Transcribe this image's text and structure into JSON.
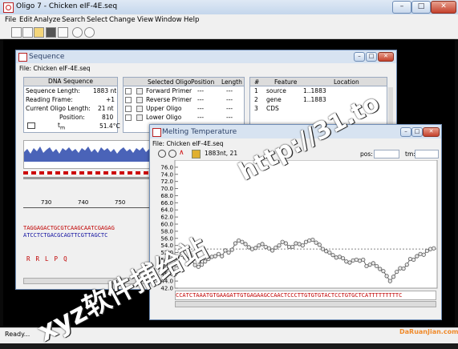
{
  "app": {
    "title": "Oligo 7 - Chicken eIF-4E.seq",
    "status": "Ready..."
  },
  "menu": [
    "File",
    "Edit",
    "Analyze",
    "Search",
    "Select",
    "Change",
    "View",
    "Window",
    "Help"
  ],
  "seqwin": {
    "title": "Sequence",
    "file": "File: Chicken eIF-4E.seq",
    "dna_header": "DNA Sequence",
    "dna_rows": [
      {
        "label": "Sequence Length:",
        "value": "1883 nt"
      },
      {
        "label": "Reading Frame:",
        "value": "+1"
      },
      {
        "label": "Current Oligo Length:",
        "value": "21 nt"
      },
      {
        "label": "Position:",
        "value": "810"
      },
      {
        "label": "",
        "value": "51.4°C"
      }
    ],
    "oligo_cols": [
      "Selected Oligo",
      "Position",
      "Length"
    ],
    "oligo_rows": [
      {
        "name": "Forward Primer",
        "pos": "---",
        "len": "---"
      },
      {
        "name": "Reverse Primer",
        "pos": "---",
        "len": "---"
      },
      {
        "name": "Upper Oligo",
        "pos": "---",
        "len": "---"
      },
      {
        "name": "Lower Oligo",
        "pos": "---",
        "len": "---"
      }
    ],
    "feat_cols": [
      "#",
      "Feature",
      "Location"
    ],
    "feat_rows": [
      {
        "n": "1",
        "feature": "source",
        "loc": "1..1883"
      },
      {
        "n": "2",
        "feature": "gene",
        "loc": "1..1883"
      },
      {
        "n": "3",
        "feature": "CDS",
        "loc": ""
      }
    ],
    "ruler": [
      "730",
      "740",
      "750"
    ],
    "seq_top": "TAGGAGACTGCGTCAAGCAATCGAGAG",
    "seq_bot": "ATCCTCTGACGCAGTTCGTTAGCTC",
    "aa": [
      "R",
      "R",
      "L",
      "P",
      "Q",
      "",
      "",
      "",
      "",
      "",
      "E"
    ]
  },
  "tm": {
    "title": "Melting Temperature",
    "file": "File: Chicken eIF-4E.seq",
    "info": "1883nt, 21",
    "pos_label": "pos:",
    "tm_label": "tm:",
    "xticks": [
      "810",
      "820",
      "830",
      "840",
      "850",
      "860",
      "870",
      "880"
    ],
    "seq": "CCATCTAAATGTGAAGATTGTGAGAAGCCAACTCCCTTGTGTGTACTCCTGTGCTCATTTTTTTTTC"
  },
  "chart_data": {
    "type": "line",
    "title": "",
    "xlabel": "",
    "ylabel": "",
    "xlim": [
      808,
      886
    ],
    "ylim": [
      42,
      78
    ],
    "yticks": [
      "76.0",
      "74.0",
      "72.0",
      "70.0",
      "68.0",
      "66.0",
      "64.0",
      "62.0",
      "60.0",
      "58.0",
      "56.0",
      "54.0",
      "52.0",
      "50.0",
      "48.0",
      "46.0",
      "44.0",
      "42.0"
    ],
    "reference_line": 53.0,
    "x": [
      810,
      811,
      812,
      813,
      814,
      815,
      816,
      817,
      818,
      819,
      820,
      821,
      822,
      823,
      824,
      825,
      826,
      827,
      828,
      829,
      830,
      831,
      832,
      833,
      834,
      835,
      836,
      837,
      838,
      839,
      840,
      841,
      842,
      843,
      844,
      845,
      846,
      847,
      848,
      849,
      850,
      851,
      852,
      853,
      854,
      855,
      856,
      857,
      858,
      859,
      860,
      861,
      862,
      863,
      864,
      865,
      866,
      867,
      868,
      869,
      870,
      871,
      872,
      873,
      874,
      875,
      876,
      877,
      878,
      879,
      880,
      881,
      882,
      883,
      884,
      885
    ],
    "y": [
      51.4,
      50.6,
      50.2,
      49.8,
      48.5,
      48.0,
      48.6,
      49.5,
      50.2,
      50.8,
      51.0,
      51.6,
      51.0,
      52.6,
      52.0,
      52.8,
      54.6,
      55.4,
      55.0,
      54.4,
      53.5,
      53.0,
      53.3,
      54.0,
      54.4,
      53.6,
      53.2,
      52.6,
      53.4,
      54.0,
      55.0,
      54.6,
      53.6,
      53.6,
      54.6,
      54.4,
      54.0,
      55.0,
      55.4,
      55.6,
      54.8,
      54.2,
      53.0,
      52.4,
      52.0,
      51.3,
      50.6,
      50.8,
      50.4,
      49.5,
      49.2,
      49.8,
      50.0,
      49.7,
      50.0,
      48.2,
      48.6,
      49.0,
      48.2,
      47.4,
      46.8,
      45.4,
      44.0,
      45.2,
      46.6,
      47.6,
      47.5,
      48.6,
      50.2,
      50.0,
      51.0,
      51.6,
      51.4,
      52.5,
      53.0,
      53.2
    ]
  },
  "watermarks": [
    "xyz软件捕给站",
    "http://31.to",
    "DaRuanJian.com"
  ],
  "colors": {
    "titlebar": "#c4d6ec",
    "workspace": "#0a0a0a",
    "tm_line": "#666666",
    "seq_red": "#c00000",
    "seq_blue": "#1010a0",
    "close": "#c4412c"
  }
}
